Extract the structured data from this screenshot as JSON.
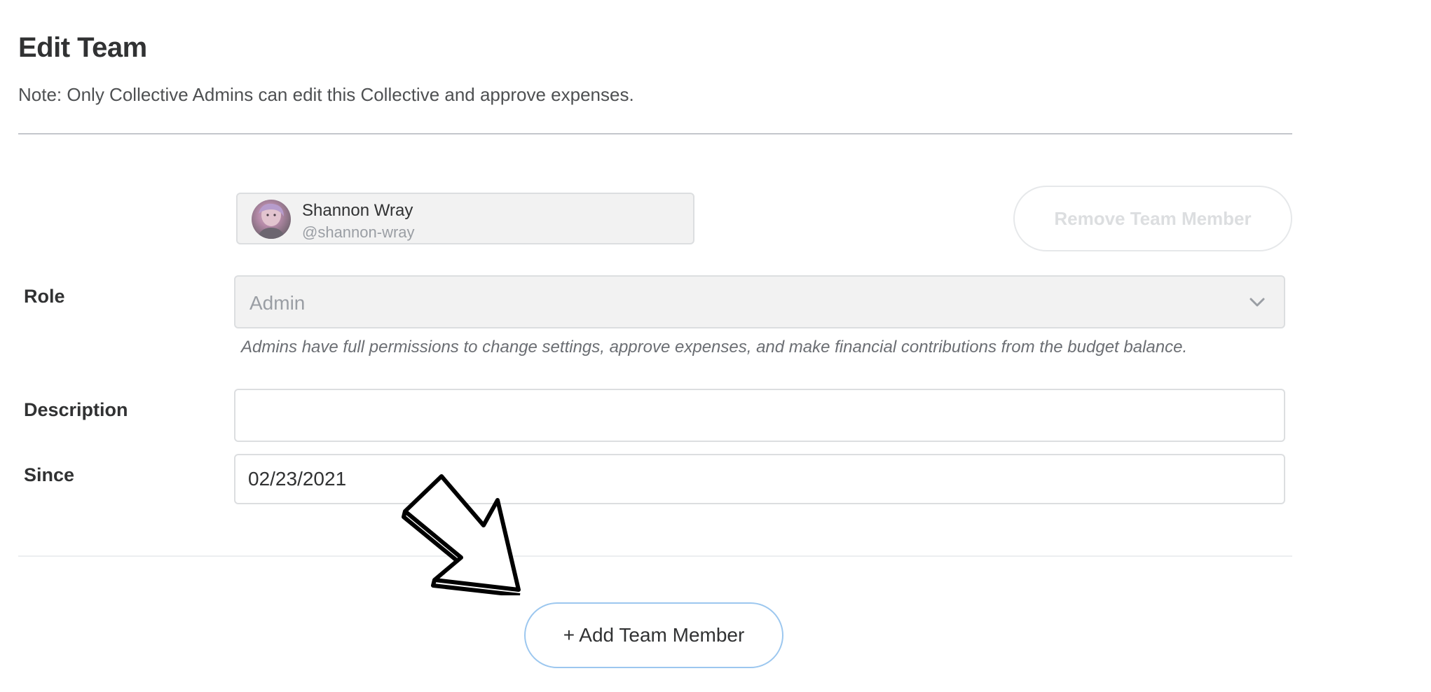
{
  "page": {
    "title": "Edit Team",
    "note": "Note: Only Collective Admins can edit this Collective and approve expenses."
  },
  "member": {
    "name": "Shannon Wray",
    "handle": "@shannon-wray",
    "remove_label": "Remove Team Member"
  },
  "form": {
    "role_label": "Role",
    "role_value": "Admin",
    "role_help": "Admins have full permissions to change settings, approve expenses, and make financial contributions from the budget balance.",
    "description_label": "Description",
    "description_value": "",
    "since_label": "Since",
    "since_value": "02/23/2021"
  },
  "actions": {
    "add_label": "+ Add Team Member"
  },
  "icons": {
    "select": "chevron-down-icon",
    "pointer": "arrow-pointer-icon"
  },
  "colors": {
    "text": "#313233",
    "muted": "#9a9ea4",
    "add_button_border": "#9cc7ef",
    "field_background": "#f2f2f2"
  }
}
